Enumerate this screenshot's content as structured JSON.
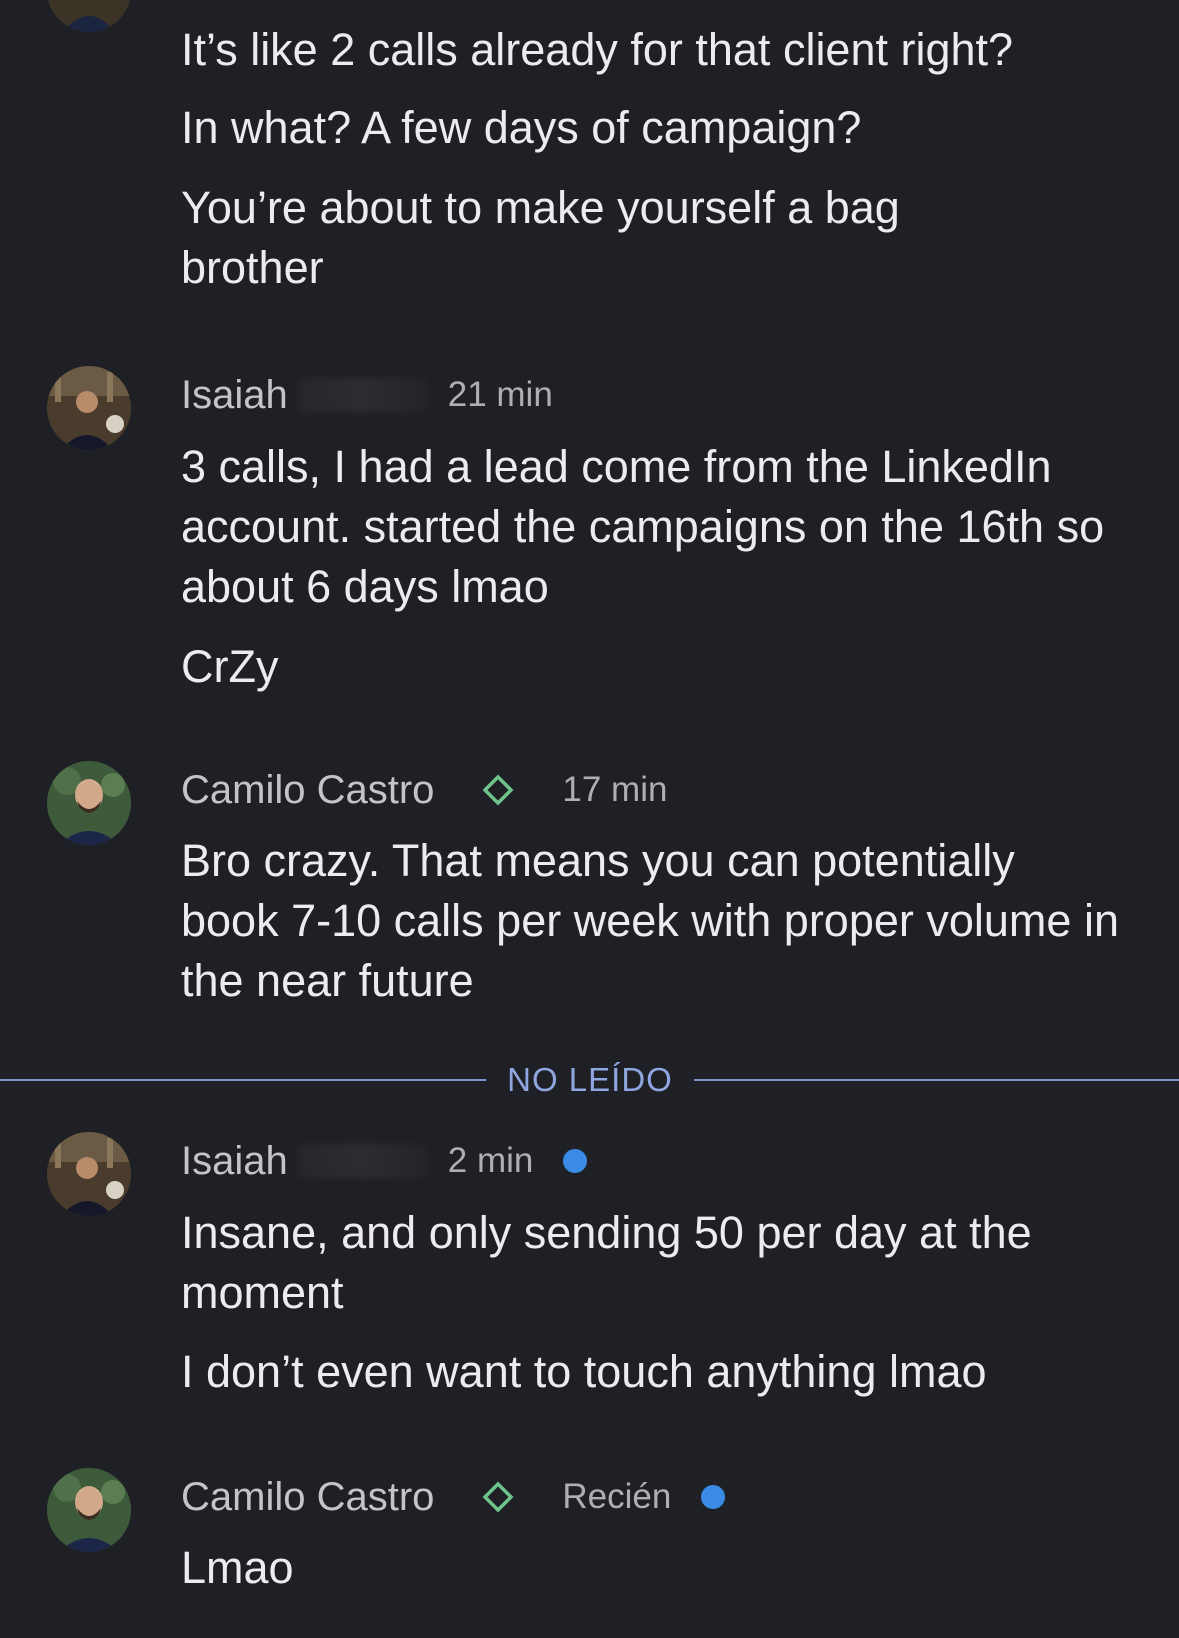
{
  "messages_top": {
    "lines": [
      "It’s like 2 calls already for that client right?",
      "In what? A few days of campaign?",
      "You’re about to make yourself a bag brother"
    ]
  },
  "group1": {
    "author": "Isaiah",
    "time": "21 min",
    "lines": [
      "3 calls, I had a lead come from the LinkedIn account. started the campaigns on the 16th so about 6 days lmao",
      "CrZy"
    ]
  },
  "group2": {
    "author": "Camilo Castro",
    "time": "17 min",
    "badge_icon": "diamond-outline-icon",
    "badge_color": "#6fc28a",
    "lines": [
      "Bro crazy. That means you can potentially book 7-10 calls per week with proper volume in the near future"
    ]
  },
  "unread_divider": {
    "label": "NO LEÍDO",
    "color": "#8fa6e0"
  },
  "group3": {
    "author": "Isaiah",
    "time": "2 min",
    "unread": true,
    "lines": [
      "Insane, and only sending 50 per day at the moment",
      "I don’t even want to touch anything lmao"
    ]
  },
  "group4": {
    "author": "Camilo Castro",
    "time": "Recién",
    "badge_icon": "diamond-outline-icon",
    "unread": true,
    "unread_color": "#3b8ae6",
    "lines": [
      "Lmao"
    ]
  }
}
